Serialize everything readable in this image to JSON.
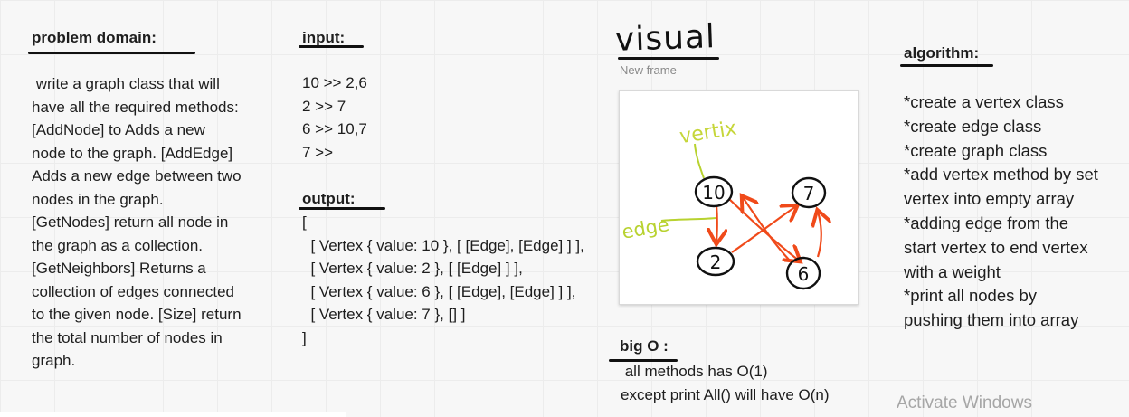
{
  "problem_domain": {
    "heading": "problem domain:",
    "lines": [
      " write a graph class that will",
      "have all the required methods:",
      "[AddNode] to Adds a new",
      "node to the graph. [AddEdge]",
      "Adds a new edge between two",
      "nodes in the graph.",
      "[GetNodes] return all node in",
      "the graph as a collection.",
      "[GetNeighbors] Returns a",
      "collection of edges connected",
      "to the given node. [Size] return",
      "the total number of nodes in",
      "graph."
    ]
  },
  "input": {
    "heading": "input:",
    "lines": [
      "10 >> 2,6",
      "2 >> 7",
      "6 >> 10,7",
      "7 >>"
    ]
  },
  "output": {
    "heading": "output:",
    "lines": [
      "[",
      "  [ Vertex { value: 10 }, [ [Edge], [Edge] ] ],",
      "  [ Vertex { value: 2 }, [ [Edge] ] ],",
      "  [ Vertex { value: 6 }, [ [Edge], [Edge] ] ],",
      "  [ Vertex { value: 7 }, [] ]",
      "]"
    ]
  },
  "visual": {
    "title": "visual",
    "frame_label": "New frame",
    "labels": {
      "vertex": "vertix",
      "edge": "edge"
    },
    "nodes": [
      "10",
      "7",
      "2",
      "6"
    ],
    "colors": {
      "node": "#111111",
      "vertex_label": "#c6d63a",
      "edge_label": "#b8d230",
      "edge": "#f04a1a"
    }
  },
  "big_o": {
    "heading": "big O :",
    "lines": [
      " all methods has O(1)",
      "except print All() will have O(n)"
    ]
  },
  "algorithm": {
    "heading": "algorithm:",
    "lines": [
      "*create a vertex class",
      "*create edge class",
      "*create graph class",
      "*add vertex method by set",
      "vertex into empty array",
      "*adding edge from the",
      "start vertex to end vertex",
      "with a weight",
      "*print all nodes by",
      "pushing them into array"
    ]
  },
  "watermark": "Activate Windows"
}
